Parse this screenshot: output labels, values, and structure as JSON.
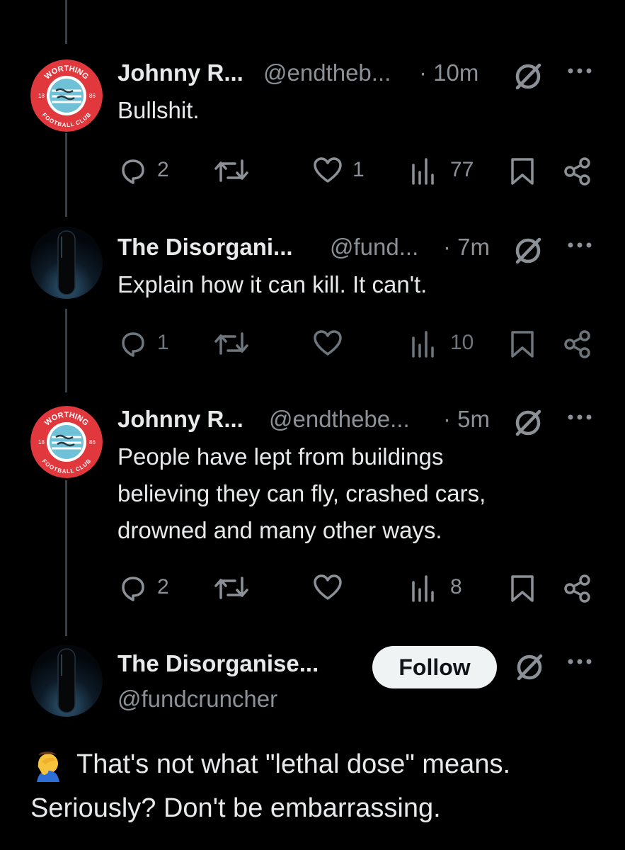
{
  "tweets": [
    {
      "name": "Johnny R...",
      "handle": "@endtheb...",
      "time": "· 10m",
      "avatar": "worthing-fc-badge",
      "text": [
        "Bullshit."
      ],
      "replies": "2",
      "likes": "1",
      "views": "77"
    },
    {
      "name": "The Disorgani...",
      "handle": "@fund...",
      "time": "· 7m",
      "avatar": "black-capsule",
      "text": [
        "Explain how it can kill.  It can't."
      ],
      "replies": "1",
      "likes": "",
      "views": "10"
    },
    {
      "name": "Johnny R...",
      "handle": "@endthebe...",
      "time": "· 5m",
      "avatar": "worthing-fc-badge",
      "text": [
        "People have lept from buildings",
        "believing they can fly, crashed cars,",
        "drowned and many other ways."
      ],
      "replies": "2",
      "likes": "",
      "views": "8"
    }
  ],
  "main_tweet": {
    "name": "The Disorganise...",
    "handle": "@fundcruncher",
    "follow_label": "Follow",
    "emoji_icon": "face-palm-icon",
    "text": [
      "That's not what \"lethal dose\" means.",
      "Seriously?  Don't be embarrassing."
    ]
  },
  "badge": {
    "top": "WORTHING",
    "bottom": "FOOTBALL CLUB",
    "left": "18",
    "right": "86"
  },
  "colors": {
    "background": "#000000",
    "text": "#e7e9ea",
    "secondary": "#8b9197",
    "badge_red": "#e0383d",
    "follow_bg": "#eff3f4"
  }
}
